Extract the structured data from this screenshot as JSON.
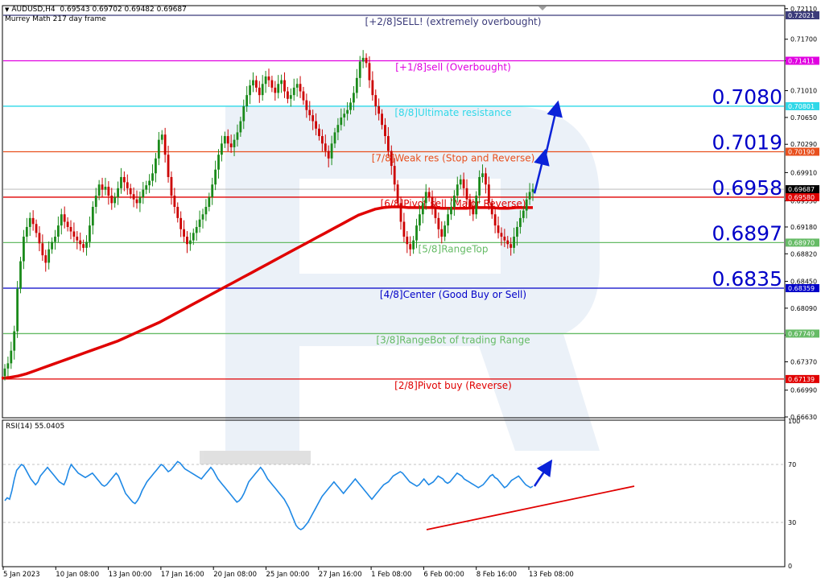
{
  "header": {
    "symbol": "AUDUSD,H4",
    "ohlc": "0.69543 0.69702 0.69482 0.69687",
    "indicator": "Murrey Math 217 day frame"
  },
  "rsi_title": "RSI(14) 55.0405",
  "colors": {
    "bullish": "#1a8a1a",
    "bearish": "#cc0000",
    "ma": "#e00000",
    "rsi": "#1e88e5",
    "arrow": "#0a22d8",
    "trendline": "#e00000",
    "watermark": "#dbe6f3"
  },
  "chart_data": [
    {
      "type": "line",
      "title": "AUDUSD,H4",
      "ylim": [
        0.6663,
        0.7214
      ],
      "y_ticks": [
        "0.72110",
        "0.71700",
        "0.71410",
        "0.71010",
        "0.70650",
        "0.70290",
        "0.69910",
        "0.69530",
        "0.69180",
        "0.68820",
        "0.68450",
        "0.68090",
        "0.67730",
        "0.67370",
        "0.66990",
        "0.66630"
      ],
      "x_ticks": [
        "5 Jan 2023",
        "10 Jan 08:00",
        "13 Jan 00:00",
        "17 Jan 16:00",
        "20 Jan 08:00",
        "25 Jan 00:00",
        "27 Jan 16:00",
        "1 Feb 08:00",
        "6 Feb 00:00",
        "8 Feb 16:00",
        "13 Feb 08:00"
      ],
      "murrey_levels": [
        {
          "price": 0.72021,
          "label": "0.72021",
          "text": "[+2/8]SELL! (extremely overbought)",
          "color": "#3b3b7a"
        },
        {
          "price": 0.71411,
          "label": "0.71411",
          "text": "[+1/8]sell (Overbought)",
          "color": "#e000e0"
        },
        {
          "price": 0.70801,
          "label": "0.70801",
          "text": "[8/8]Ultimate resistance",
          "color": "#2fd8e8"
        },
        {
          "price": 0.7019,
          "label": "0.70190",
          "text": "[7/8]Weak res (Stop and Reverse)",
          "color": "#e8501e"
        },
        {
          "price": 0.6958,
          "label": "0.69580",
          "text": "[6/8]Pivot sell (Major Reverse)",
          "color": "#e00000"
        },
        {
          "price": 0.6897,
          "label": "0.68970",
          "text": "[5/8]RangeTop",
          "color": "#66bb66"
        },
        {
          "price": 0.68359,
          "label": "0.68359",
          "text": "[4/8]Center (Good Buy or Sell)",
          "color": "#0000c8"
        },
        {
          "price": 0.67749,
          "label": "0.67749",
          "text": "[3/8]RangeBot of trading Range",
          "color": "#66bb66"
        },
        {
          "price": 0.67139,
          "label": "0.67139",
          "text": "[2/8]Pivot buy (Reverse)",
          "color": "#e00000"
        }
      ],
      "big_labels": [
        {
          "price": 0.70801,
          "text": "0.7080"
        },
        {
          "price": 0.7019,
          "text": "0.7019"
        },
        {
          "price": 0.6958,
          "text": "0.6958"
        },
        {
          "price": 0.6897,
          "text": "0.6897"
        },
        {
          "price": 0.68359,
          "text": "0.6835"
        }
      ],
      "current_price": {
        "price": 0.69687,
        "label": "0.69687"
      },
      "close": [
        0.6728,
        0.6735,
        0.6752,
        0.6778,
        0.6835,
        0.6872,
        0.6905,
        0.6918,
        0.693,
        0.6922,
        0.691,
        0.6896,
        0.688,
        0.687,
        0.6888,
        0.6898,
        0.6905,
        0.692,
        0.6935,
        0.6925,
        0.6918,
        0.6912,
        0.6905,
        0.69,
        0.6895,
        0.689,
        0.6898,
        0.692,
        0.6945,
        0.696,
        0.6975,
        0.6968,
        0.6972,
        0.696,
        0.695,
        0.6958,
        0.697,
        0.6985,
        0.6978,
        0.697,
        0.6962,
        0.6955,
        0.695,
        0.6958,
        0.6968,
        0.6974,
        0.698,
        0.699,
        0.701,
        0.7035,
        0.7042,
        0.7015,
        0.6985,
        0.696,
        0.6945,
        0.693,
        0.6915,
        0.6905,
        0.6895,
        0.69,
        0.691,
        0.6918,
        0.6928,
        0.6935,
        0.6945,
        0.6958,
        0.6975,
        0.6995,
        0.7015,
        0.703,
        0.704,
        0.703,
        0.7025,
        0.7035,
        0.7045,
        0.706,
        0.708,
        0.7095,
        0.7108,
        0.7115,
        0.7105,
        0.7095,
        0.711,
        0.712,
        0.7115,
        0.7105,
        0.7098,
        0.711,
        0.7115,
        0.71,
        0.709,
        0.7095,
        0.7105,
        0.711,
        0.71,
        0.7088,
        0.7075,
        0.7068,
        0.706,
        0.705,
        0.704,
        0.703,
        0.702,
        0.701,
        0.703,
        0.7045,
        0.7055,
        0.7065,
        0.707,
        0.7075,
        0.7085,
        0.7098,
        0.7118,
        0.714,
        0.7145,
        0.7138,
        0.7115,
        0.7095,
        0.708,
        0.707,
        0.7055,
        0.704,
        0.702,
        0.7,
        0.6975,
        0.695,
        0.6925,
        0.6905,
        0.6895,
        0.6888,
        0.69,
        0.692,
        0.6935,
        0.695,
        0.6965,
        0.6958,
        0.6945,
        0.693,
        0.6915,
        0.6905,
        0.692,
        0.6935,
        0.6945,
        0.696,
        0.6975,
        0.6982,
        0.697,
        0.6955,
        0.6945,
        0.6935,
        0.696,
        0.6985,
        0.699,
        0.6975,
        0.695,
        0.6935,
        0.692,
        0.691,
        0.6905,
        0.69,
        0.6895,
        0.689,
        0.6905,
        0.6918,
        0.693,
        0.694,
        0.6955,
        0.6965,
        0.6969
      ],
      "ma_217": [
        0.6715,
        0.6716,
        0.6718,
        0.6721,
        0.6725,
        0.6729,
        0.6733,
        0.6737,
        0.6741,
        0.6745,
        0.6749,
        0.6753,
        0.6757,
        0.6761,
        0.6765,
        0.677,
        0.6775,
        0.678,
        0.6785,
        0.679,
        0.6796,
        0.6802,
        0.6808,
        0.6814,
        0.682,
        0.6826,
        0.6832,
        0.6838,
        0.6844,
        0.685,
        0.6856,
        0.6862,
        0.6868,
        0.6874,
        0.688,
        0.6886,
        0.6892,
        0.6898,
        0.6904,
        0.691,
        0.6916,
        0.6922,
        0.6928,
        0.6934,
        0.6938,
        0.6942,
        0.6944,
        0.6945,
        0.6945,
        0.6944,
        0.6944,
        0.6944,
        0.6944,
        0.6943,
        0.6943,
        0.6943,
        0.6943,
        0.6944,
        0.6944,
        0.6944,
        0.6943,
        0.6943,
        0.6944,
        0.6944,
        0.6944
      ],
      "forecast_arrow": [
        [
          0.6963,
          0.7015
        ],
        [
          0.7015,
          0.708
        ]
      ]
    },
    {
      "type": "line",
      "title": "RSI(14) 55.0405",
      "ylim": [
        0,
        100
      ],
      "y_ticks": [
        "100",
        "70",
        "30",
        "0"
      ],
      "levels": [
        70,
        30
      ],
      "values": [
        45,
        47,
        46,
        52,
        60,
        66,
        68,
        70,
        69,
        66,
        63,
        60,
        58,
        56,
        58,
        62,
        64,
        66,
        68,
        66,
        64,
        62,
        60,
        58,
        57,
        56,
        60,
        66,
        70,
        68,
        66,
        64,
        63,
        62,
        61,
        62,
        63,
        64,
        62,
        60,
        58,
        56,
        55,
        56,
        58,
        60,
        62,
        64,
        62,
        58,
        54,
        50,
        48,
        46,
        44,
        43,
        45,
        48,
        52,
        55,
        58,
        60,
        62,
        64,
        66,
        68,
        70,
        69,
        67,
        65,
        66,
        68,
        70,
        72,
        71,
        69,
        67,
        66,
        65,
        64,
        63,
        62,
        61,
        60,
        62,
        64,
        66,
        68,
        66,
        63,
        60,
        58,
        56,
        54,
        52,
        50,
        48,
        46,
        44,
        45,
        47,
        50,
        54,
        58,
        60,
        62,
        64,
        66,
        68,
        66,
        63,
        60,
        58,
        56,
        54,
        52,
        50,
        48,
        46,
        43,
        40,
        36,
        32,
        28,
        26,
        25,
        26,
        28,
        30,
        33,
        36,
        39,
        42,
        45,
        48,
        50,
        52,
        54,
        56,
        58,
        56,
        54,
        52,
        50,
        52,
        54,
        56,
        58,
        60,
        58,
        56,
        54,
        52,
        50,
        48,
        46,
        48,
        50,
        52,
        54,
        56,
        57,
        58,
        60,
        62,
        63,
        64,
        65,
        64,
        62,
        60,
        58,
        57,
        56,
        55,
        56,
        58,
        60,
        58,
        56,
        57,
        58,
        60,
        62,
        61,
        60,
        58,
        57,
        58,
        60,
        62,
        64,
        63,
        62,
        60,
        59,
        58,
        57,
        56,
        55,
        54,
        55,
        56,
        58,
        60,
        62,
        63,
        61,
        60,
        58,
        56,
        54,
        55,
        57,
        59,
        60,
        61,
        62,
        60,
        58,
        56,
        55,
        54,
        55
      ],
      "trendline": [
        [
          25,
          55
        ]
      ],
      "forecast_arrow": [
        [
          55,
          70
        ]
      ]
    }
  ]
}
